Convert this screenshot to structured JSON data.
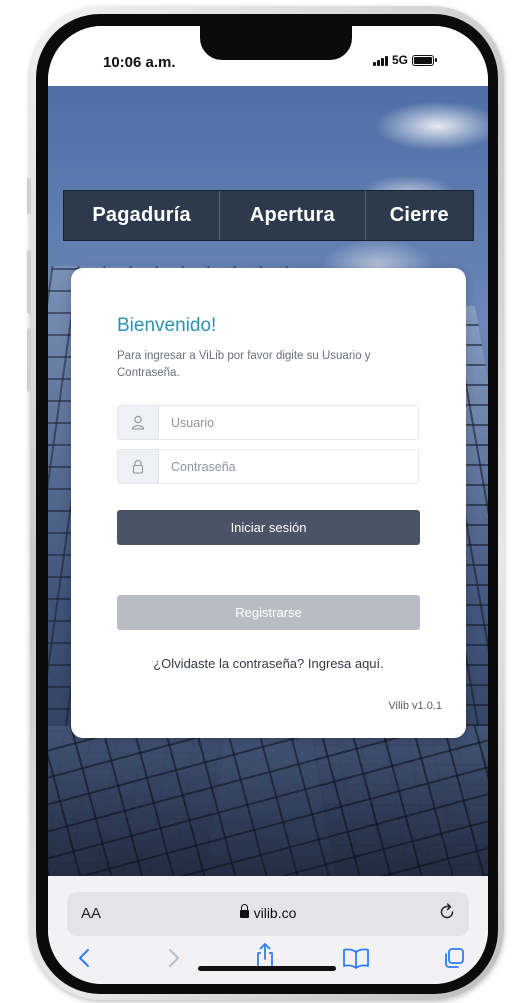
{
  "status_bar": {
    "time": "10:06 a.m.",
    "network": "5G"
  },
  "tabs": [
    {
      "label": "Pagaduría"
    },
    {
      "label": "Apertura"
    },
    {
      "label": "Cierre"
    }
  ],
  "login": {
    "title": "Bienvenido!",
    "description": "Para ingresar a ViLib por favor digite su Usuario y Contraseña.",
    "user_placeholder": "Usuario",
    "password_placeholder": "Contraseña",
    "login_button": "Iniciar sesión",
    "register_button": "Registrarse",
    "forgot_link": "¿Olvidaste la contraseña? Ingresa aquí.",
    "version": "Vilib v1.0.1"
  },
  "browser": {
    "aa_label": "AA",
    "url": "vilib.co"
  },
  "colors": {
    "tab_bar": "#2d3a4d",
    "title_accent": "#2a93b5",
    "login_button": "#4b5366",
    "register_button": "#b8bcc4",
    "ios_blue": "#2f7cf6"
  }
}
